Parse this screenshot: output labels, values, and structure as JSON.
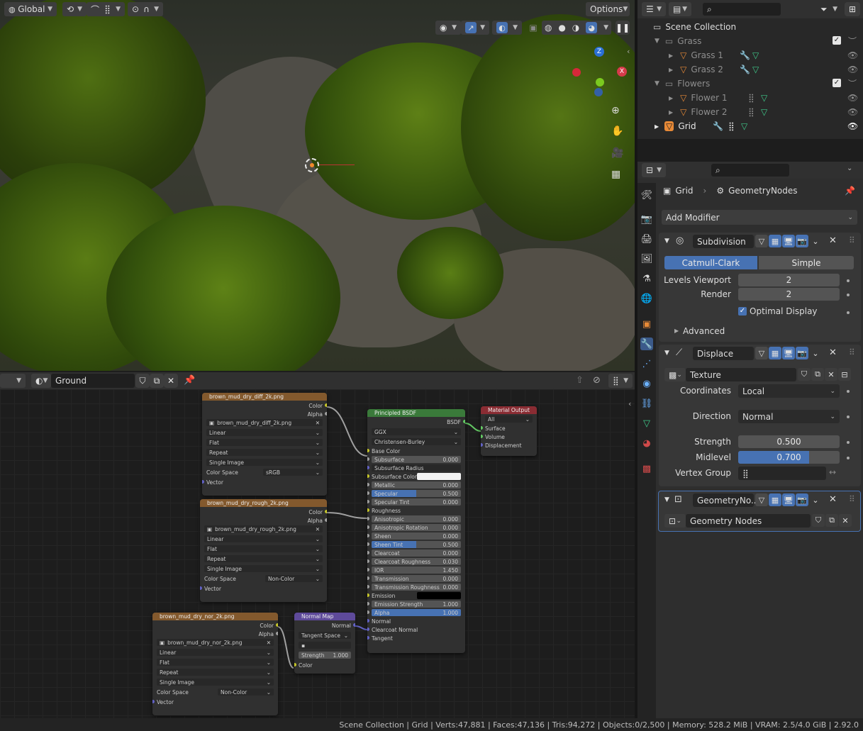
{
  "viewport_header": {
    "orientation": "Global",
    "options": "Options"
  },
  "node_header": {
    "material": "Ground"
  },
  "outliner": {
    "title": "Scene Collection",
    "items": [
      {
        "label": "Grass"
      },
      {
        "label": "Grass 1"
      },
      {
        "label": "Grass 2"
      },
      {
        "label": "Flowers"
      },
      {
        "label": "Flower 1"
      },
      {
        "label": "Flower 2"
      },
      {
        "label": "Grid"
      }
    ]
  },
  "properties": {
    "breadcrumb_object": "Grid",
    "breadcrumb_modifier": "GeometryNodes",
    "add_modifier": "Add Modifier",
    "subdivision": {
      "name": "Subdivision",
      "tab_catmull": "Catmull-Clark",
      "tab_simple": "Simple",
      "levels_viewport_label": "Levels Viewport",
      "levels_viewport": "2",
      "render_label": "Render",
      "render": "2",
      "optimal_display": "Optimal Display",
      "advanced": "Advanced"
    },
    "displace": {
      "name": "Displace",
      "texture": "Texture",
      "coordinates_label": "Coordinates",
      "coordinates": "Local",
      "direction_label": "Direction",
      "direction": "Normal",
      "strength_label": "Strength",
      "strength": "0.500",
      "midlevel_label": "Midlevel",
      "midlevel": "0.700",
      "midlevel_fraction": 0.7,
      "vertex_group_label": "Vertex Group"
    },
    "geonodes": {
      "name": "GeometryNo...",
      "tree": "Geometry Nodes"
    }
  },
  "nodes": {
    "diff": {
      "title": "brown_mud_dry_diff_2k.png",
      "out_color": "Color",
      "out_alpha": "Alpha",
      "image": "brown_mud_dry_diff_2k.png",
      "interp": "Linear",
      "proj": "Flat",
      "ext": "Repeat",
      "src": "Single Image",
      "cs_label": "Color Space",
      "cs": "sRGB",
      "in_vector": "Vector"
    },
    "rough": {
      "title": "brown_mud_dry_rough_2k.png",
      "out_color": "Color",
      "out_alpha": "Alpha",
      "image": "brown_mud_dry_rough_2k.png",
      "interp": "Linear",
      "proj": "Flat",
      "ext": "Repeat",
      "src": "Single Image",
      "cs_label": "Color Space",
      "cs": "Non-Color",
      "in_vector": "Vector"
    },
    "nor": {
      "title": "brown_mud_dry_nor_2k.png",
      "out_color": "Color",
      "out_alpha": "Alpha",
      "image": "brown_mud_dry_nor_2k.png",
      "interp": "Linear",
      "proj": "Flat",
      "ext": "Repeat",
      "src": "Single Image",
      "cs_label": "Color Space",
      "cs": "Non-Color",
      "in_vector": "Vector"
    },
    "normalmap": {
      "title": "Normal Map",
      "out_normal": "Normal",
      "space": "Tangent Space",
      "strength_label": "Strength",
      "strength": "1.000",
      "in_color": "Color"
    },
    "bsdf": {
      "title": "Principled BSDF",
      "out": "BSDF",
      "dist": "GGX",
      "sss": "Christensen-Burley",
      "base_color": "Base Color",
      "rows": [
        {
          "label": "Subsurface",
          "value": "0.000"
        },
        {
          "label": "Subsurface Radius",
          "value": ""
        },
        {
          "label": "Subsurface Color",
          "value": ""
        },
        {
          "label": "Metallic",
          "value": "0.000"
        },
        {
          "label": "Specular",
          "value": "0.500"
        },
        {
          "label": "Specular Tint",
          "value": "0.000"
        },
        {
          "label": "Roughness",
          "value": ""
        },
        {
          "label": "Anisotropic",
          "value": "0.000"
        },
        {
          "label": "Anisotropic Rotation",
          "value": "0.000"
        },
        {
          "label": "Sheen",
          "value": "0.000"
        },
        {
          "label": "Sheen Tint",
          "value": "0.500"
        },
        {
          "label": "Clearcoat",
          "value": "0.000"
        },
        {
          "label": "Clearcoat Roughness",
          "value": "0.030"
        },
        {
          "label": "IOR",
          "value": "1.450"
        },
        {
          "label": "Transmission",
          "value": "0.000"
        },
        {
          "label": "Transmission Roughness",
          "value": "0.000"
        },
        {
          "label": "Emission",
          "value": ""
        },
        {
          "label": "Emission Strength",
          "value": "1.000"
        },
        {
          "label": "Alpha",
          "value": "1.000"
        },
        {
          "label": "Normal",
          "value": ""
        },
        {
          "label": "Clearcoat Normal",
          "value": ""
        },
        {
          "label": "Tangent",
          "value": ""
        }
      ]
    },
    "output": {
      "title": "Material Output",
      "target": "All",
      "surface": "Surface",
      "volume": "Volume",
      "displacement": "Displacement"
    }
  },
  "status": {
    "text": "Scene Collection | Grid | Verts:47,881 | Faces:47,136 | Tris:94,272 | Objects:0/2,500 | Memory: 528.2 MiB | VRAM: 2.5/4.0 GiB | 2.92.0"
  },
  "colors": {
    "accent": "#4772b3",
    "image_header": "#83592d",
    "bsdf_header": "#3a7a3a",
    "output_header": "#8a2c33",
    "vector_header": "#5e4a9a"
  }
}
